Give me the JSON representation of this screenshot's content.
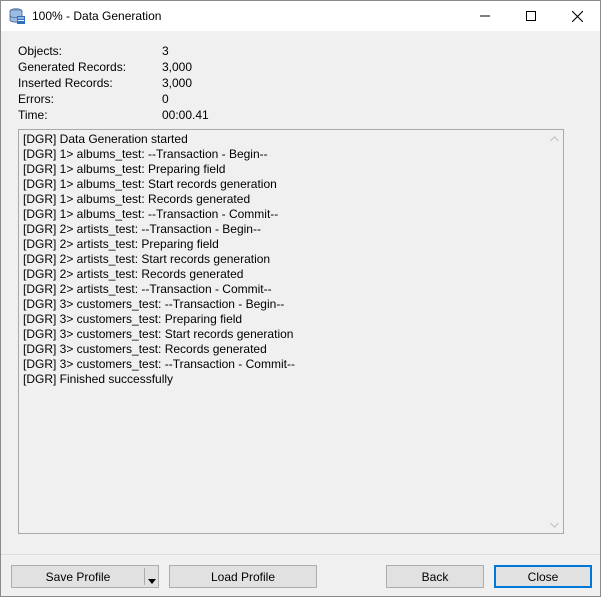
{
  "window": {
    "title": "100% - Data Generation",
    "app_icon": "database-icon"
  },
  "stats": [
    {
      "label": "Objects:",
      "value": "3"
    },
    {
      "label": "Generated Records:",
      "value": "3,000"
    },
    {
      "label": "Inserted Records:",
      "value": "3,000"
    },
    {
      "label": "Errors:",
      "value": "0"
    },
    {
      "label": "Time:",
      "value": "00:00.41"
    }
  ],
  "log": [
    "[DGR] Data Generation started",
    "[DGR] 1> albums_test: --Transaction - Begin--",
    "[DGR] 1> albums_test: Preparing field",
    "[DGR] 1> albums_test: Start records generation",
    "[DGR] 1> albums_test: Records generated",
    "[DGR] 1> albums_test: --Transaction - Commit--",
    "[DGR] 2> artists_test: --Transaction - Begin--",
    "[DGR] 2> artists_test: Preparing field",
    "[DGR] 2> artists_test: Start records generation",
    "[DGR] 2> artists_test: Records generated",
    "[DGR] 2> artists_test: --Transaction - Commit--",
    "[DGR] 3> customers_test: --Transaction - Begin--",
    "[DGR] 3> customers_test: Preparing field",
    "[DGR] 3> customers_test: Start records generation",
    "[DGR] 3> customers_test: Records generated",
    "[DGR] 3> customers_test: --Transaction - Commit--",
    "[DGR] Finished successfully"
  ],
  "buttons": {
    "save_profile": "Save Profile",
    "load_profile": "Load Profile",
    "back": "Back",
    "close": "Close"
  },
  "colors": {
    "accent": "#0078d7",
    "button_face": "#e1e1e1",
    "window_bg": "#f0f0f0"
  }
}
